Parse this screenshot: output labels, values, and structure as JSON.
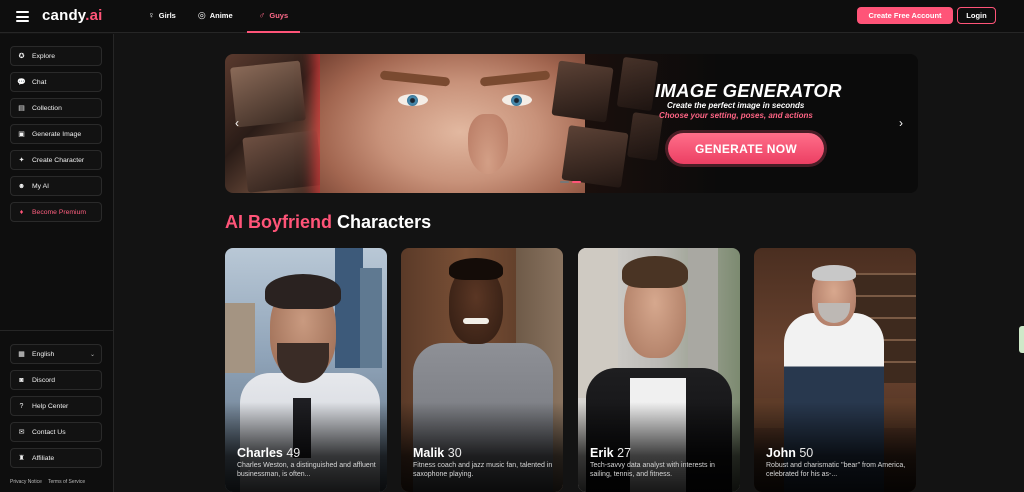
{
  "header": {
    "logo_main": "candy",
    "logo_dot": ".ai",
    "nav": [
      {
        "label": "Girls",
        "icon": "female-icon"
      },
      {
        "label": "Anime",
        "icon": "anime-icon"
      },
      {
        "label": "Guys",
        "icon": "male-icon",
        "active": true
      }
    ],
    "create_account_label": "Create Free Account",
    "login_label": "Login"
  },
  "sidebar": {
    "items": [
      {
        "label": "Explore",
        "icon": "compass-icon"
      },
      {
        "label": "Chat",
        "icon": "chat-icon"
      },
      {
        "label": "Collection",
        "icon": "collection-icon"
      },
      {
        "label": "Generate Image",
        "icon": "image-icon"
      },
      {
        "label": "Create Character",
        "icon": "wand-icon"
      },
      {
        "label": "My AI",
        "icon": "mask-icon"
      },
      {
        "label": "Become Premium",
        "icon": "diamond-icon"
      }
    ],
    "bottom_items": [
      {
        "label": "English",
        "icon": "us-flag-icon"
      },
      {
        "label": "Discord",
        "icon": "discord-icon"
      },
      {
        "label": "Help Center",
        "icon": "help-icon"
      },
      {
        "label": "Contact Us",
        "icon": "mail-icon"
      },
      {
        "label": "Affiliate",
        "icon": "trophy-icon"
      }
    ],
    "footer": {
      "privacy": "Privacy Notice",
      "terms": "Terms of Service"
    }
  },
  "banner": {
    "title": "IMAGE GENERATOR",
    "subtitle": "Create the perfect image in seconds",
    "subtitle2": "Choose your setting, poses, and actions",
    "cta_label": "GENERATE NOW",
    "prev_icon": "chevron-left-icon",
    "next_icon": "chevron-right-icon",
    "slide_count": 2,
    "active_slide": 2
  },
  "section": {
    "title_accent": "AI Boyfriend",
    "title_rest": "Characters"
  },
  "cards": [
    {
      "name": "Charles",
      "age": "49",
      "desc": "Charles Weston, a distinguished and affluent businessman, is often..."
    },
    {
      "name": "Malik",
      "age": "30",
      "desc": "Fitness coach and jazz music fan, talented in saxophone playing."
    },
    {
      "name": "Erik",
      "age": "27",
      "desc": "Tech-savvy data analyst with interests in sailing, tennis, and fitness."
    },
    {
      "name": "John",
      "age": "50",
      "desc": "Robust and charismatic \"bear\" from America, celebrated for his as-..."
    }
  ],
  "colors": {
    "accent": "#ff5478",
    "background": "#131313"
  }
}
